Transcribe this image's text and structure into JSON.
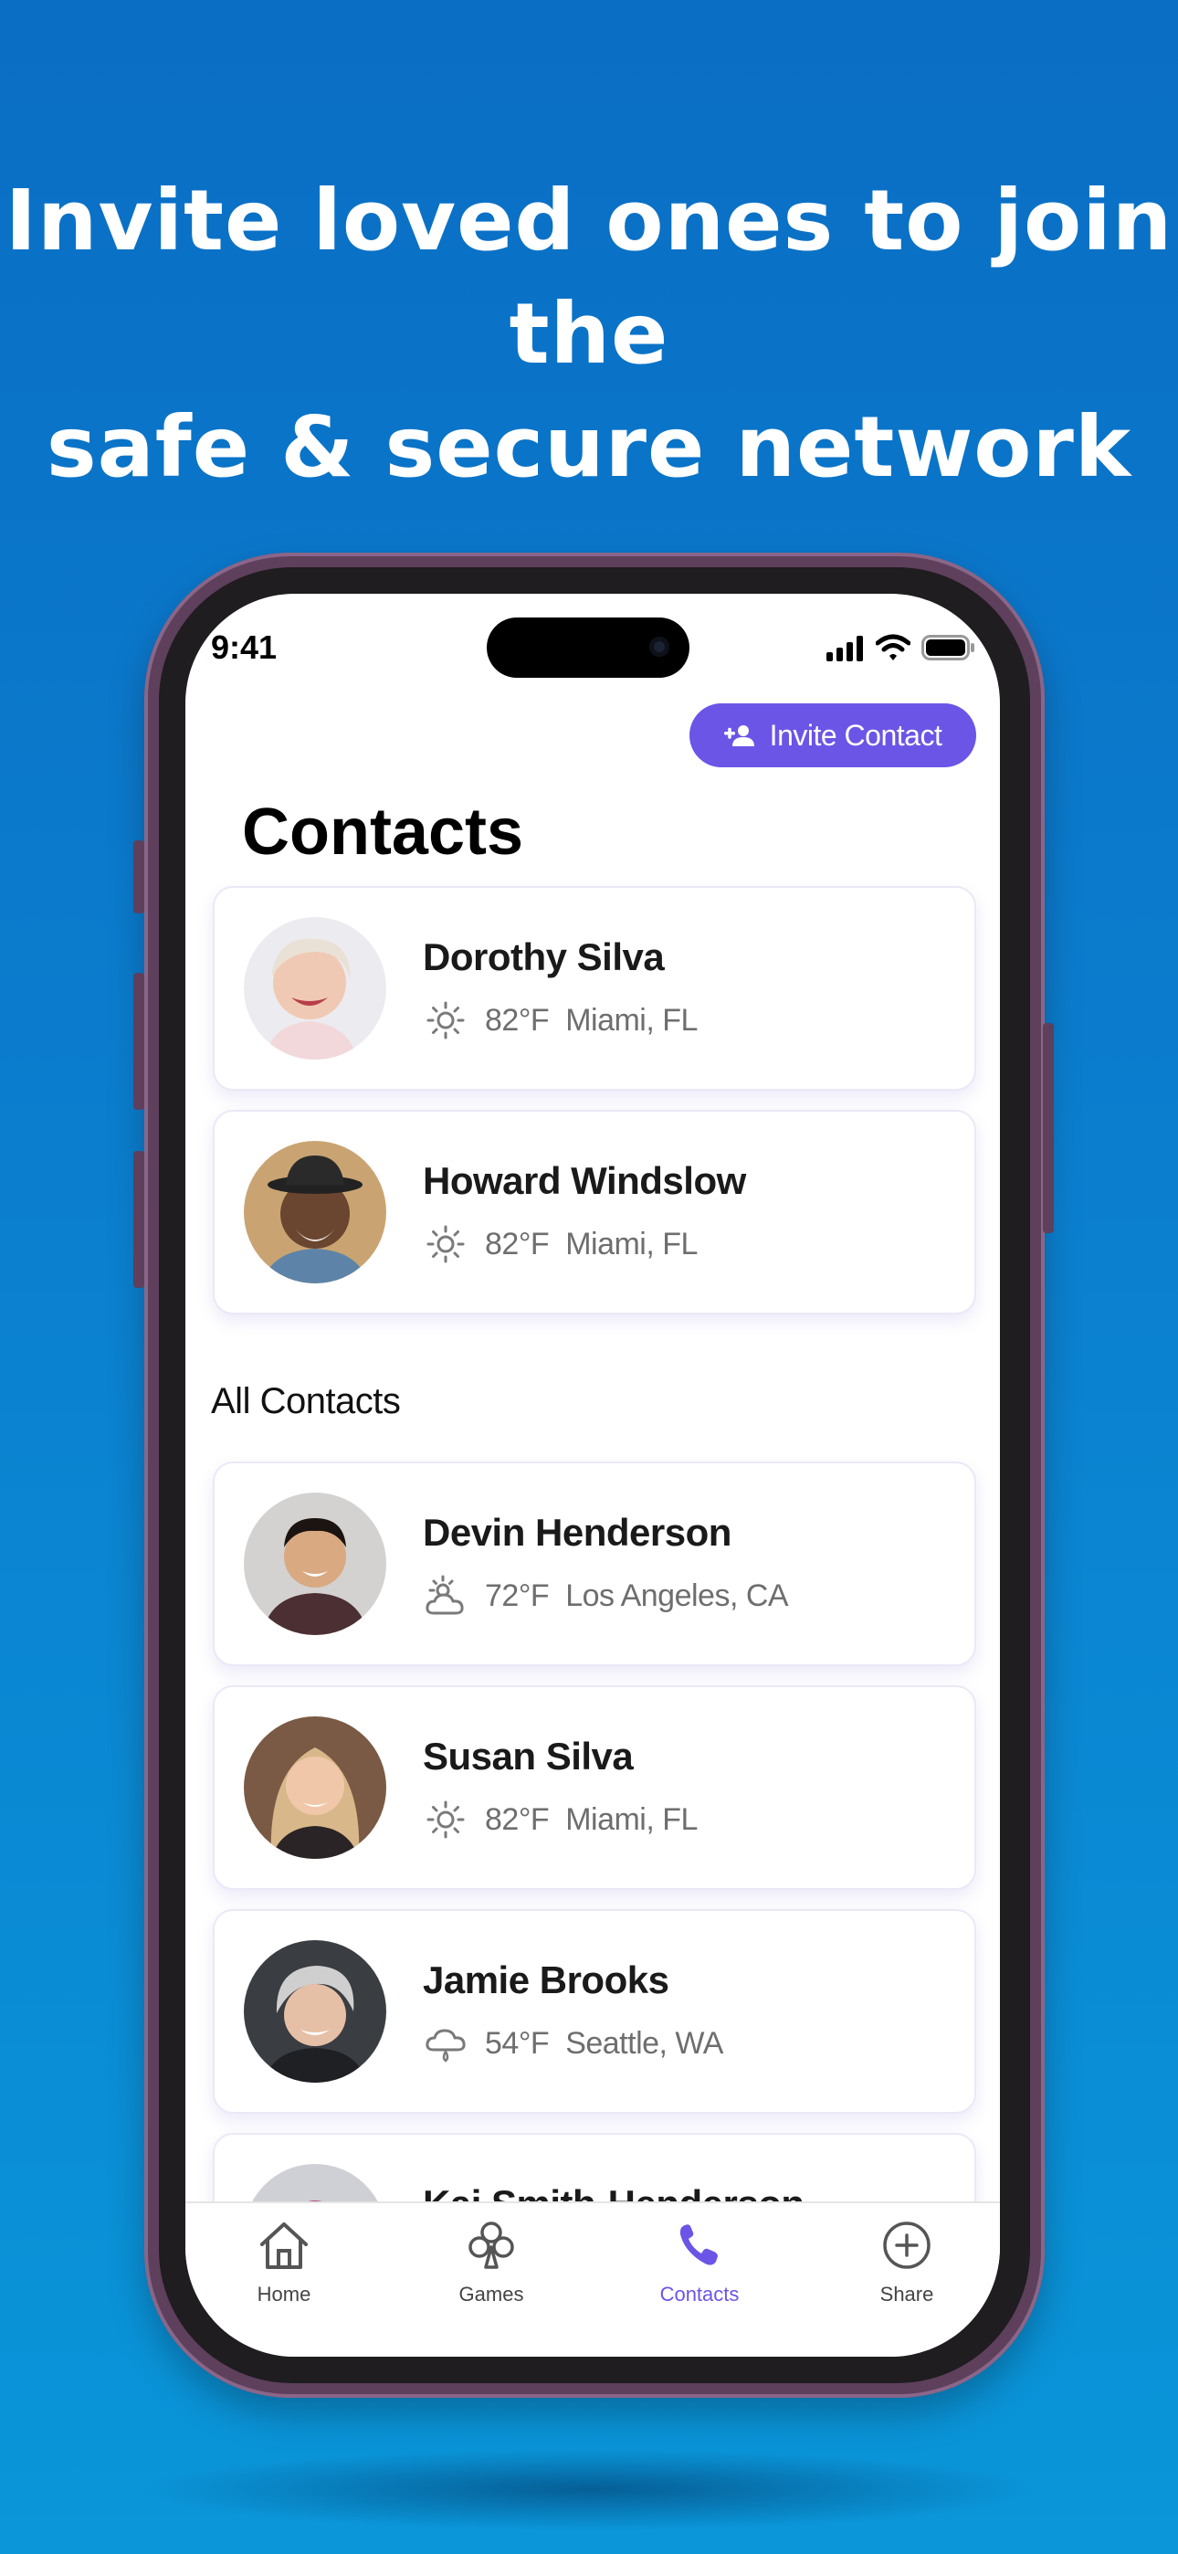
{
  "headline": {
    "line1": "Invite loved ones to join the",
    "line2": "safe & secure network"
  },
  "status_bar": {
    "time": "9:41"
  },
  "header": {
    "invite_label": "Invite Contact",
    "title": "Contacts"
  },
  "favorites": [
    {
      "name": "Dorothy Silva",
      "weather": "sun-icon",
      "temp": "82°F",
      "location": "Miami, FL"
    },
    {
      "name": "Howard Windslow",
      "weather": "sun-icon",
      "temp": "82°F",
      "location": "Miami, FL"
    }
  ],
  "all_contacts_label": "All Contacts",
  "all_contacts": [
    {
      "name": "Devin Henderson",
      "weather": "partly-cloudy-icon",
      "temp": "72°F",
      "location": "Los Angeles, CA"
    },
    {
      "name": "Susan Silva",
      "weather": "sun-icon",
      "temp": "82°F",
      "location": "Miami, FL"
    },
    {
      "name": "Jamie Brooks",
      "weather": "rain-cloud-icon",
      "temp": "54°F",
      "location": "Seattle, WA"
    },
    {
      "name": "Kai Smith-Henderson",
      "weather": "",
      "temp": "",
      "location": ""
    }
  ],
  "tabs": [
    {
      "label": "Home",
      "icon": "home-icon",
      "active": false
    },
    {
      "label": "Games",
      "icon": "club-icon",
      "active": false
    },
    {
      "label": "Contacts",
      "icon": "phone-icon",
      "active": true
    },
    {
      "label": "Share",
      "icon": "plus-circle-icon",
      "active": false
    }
  ],
  "colors": {
    "accent": "#6b55e6",
    "background": "#0a7ccd",
    "frame": "#5e3f5c"
  }
}
